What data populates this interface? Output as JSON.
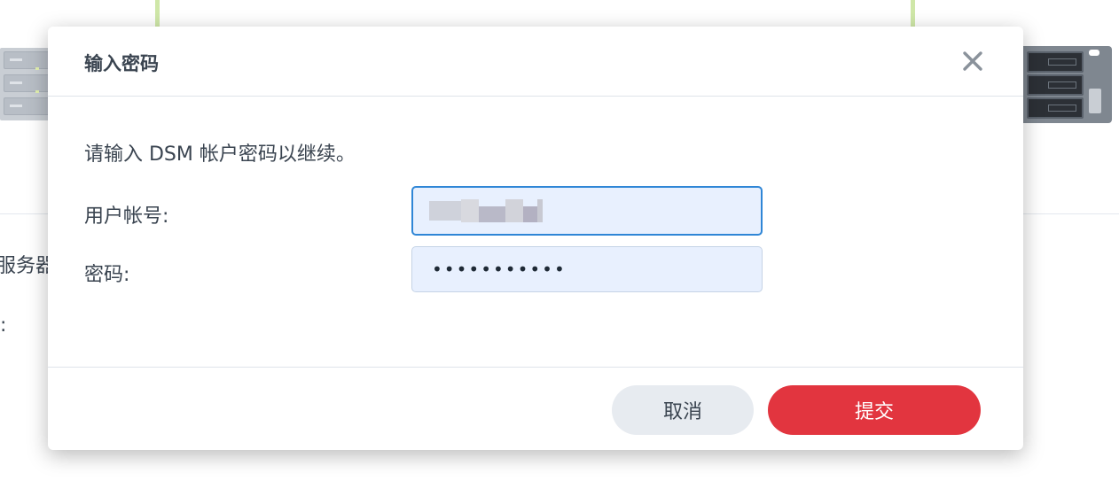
{
  "dialog": {
    "title": "输入密码",
    "intro": "请输入 DSM 帐户密码以继续。",
    "username_label": "用户帐号:",
    "username_value": "",
    "password_label": "密码:",
    "password_value": "•••••••••••",
    "cancel_label": "取消",
    "submit_label": "提交",
    "close_icon": "close-icon"
  },
  "background": {
    "text_line_1": "服务器",
    "text_line_2": "器:"
  },
  "colors": {
    "submit_button": "#e2353f",
    "cancel_button": "#e7ebf0",
    "input_background": "#e8f0fe",
    "focus_border": "#2f86d6"
  }
}
